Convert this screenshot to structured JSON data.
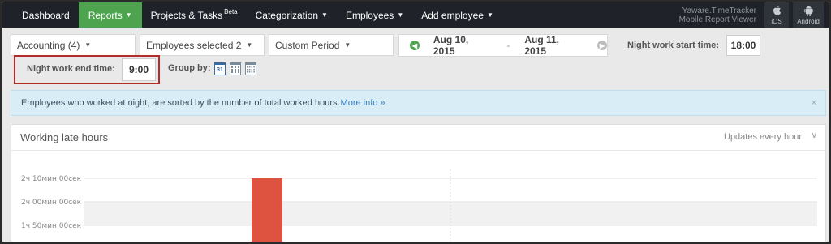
{
  "nav": {
    "items": [
      {
        "label": "Dashboard",
        "active": false,
        "caret": false,
        "sup": ""
      },
      {
        "label": "Reports",
        "active": true,
        "caret": true,
        "sup": ""
      },
      {
        "label": "Projects & Tasks",
        "active": false,
        "caret": false,
        "sup": "Beta"
      },
      {
        "label": "Categorization",
        "active": false,
        "caret": true,
        "sup": ""
      },
      {
        "label": "Employees",
        "active": false,
        "caret": true,
        "sup": ""
      },
      {
        "label": "Add employee",
        "active": false,
        "caret": true,
        "sup": ""
      }
    ],
    "brand_line1": "Yaware.TimeTracker",
    "brand_line2": "Mobile Report Viewer",
    "ios_label": "iOS",
    "android_label": "Android",
    "ios_icon": "apple-icon",
    "android_icon": "android-icon"
  },
  "filters": {
    "department": "Accounting (4)",
    "employees": "Employees selected 2",
    "period": "Custom Period",
    "date_from": "Aug 10, 2015",
    "date_sep": "-",
    "date_to": "Aug 11, 2015",
    "night_start_label": "Night work start time:",
    "night_start_value": "18:00",
    "night_end_label": "Night work end time:",
    "night_end_value": "9:00",
    "group_by_label": "Group by:",
    "group_by_day": "31"
  },
  "info": {
    "text": "Employees who worked at night, are sorted by the number of total worked hours.",
    "link": "More info »",
    "close": "×"
  },
  "panel": {
    "title": "Working late hours",
    "updates": "Updates every hour"
  },
  "colors": {
    "nav_bg": "#1f2329",
    "active": "#4ea34f",
    "bar": "#de5340",
    "highlight": "#b42b2b"
  },
  "chart_data": {
    "type": "bar",
    "y_ticks": [
      {
        "label": "2ч 10мин 00сек",
        "minutes": 130
      },
      {
        "label": "2ч 00мин 00сек",
        "minutes": 120
      },
      {
        "label": "1ч 50мин 00сек",
        "minutes": 110
      }
    ],
    "series": [
      {
        "values": [
          130
        ]
      }
    ],
    "grid": true
  }
}
